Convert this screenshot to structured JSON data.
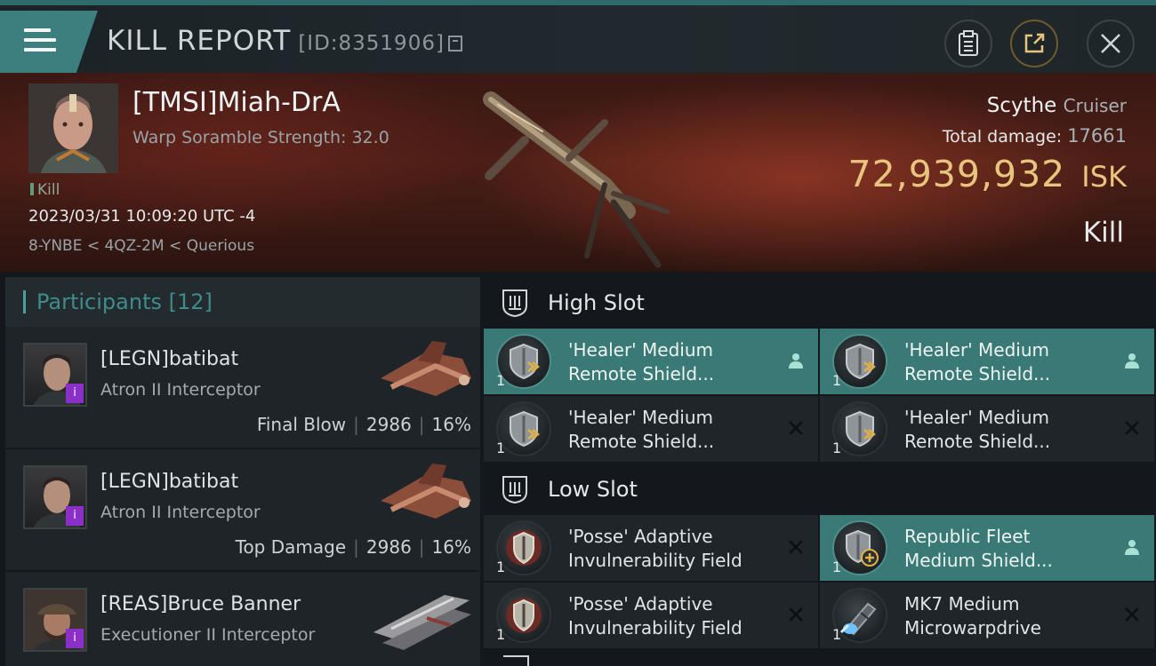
{
  "window": {
    "title": "KILL REPORT",
    "report_id": "[ID:8351906]"
  },
  "header": {
    "pilot_name": "[TMSI]Miah-DrA",
    "warp_scramble": "Warp Soramble Strength: 32.0",
    "event_tag": "Kill",
    "datetime": "2023/03/31 10:09:20 UTC -4",
    "route": "8-YNBE < 4QZ-2M < Querious",
    "ship_name": "Scythe",
    "ship_class": "Cruiser",
    "total_damage_label": "Total damage:",
    "total_damage": "17661",
    "isk_value": "72,939,932",
    "isk_unit": "ISK",
    "result": "Kill"
  },
  "participants": {
    "title": "Participants",
    "count": "[12]",
    "rows": [
      {
        "name": "[LEGN]batibat",
        "ship": "Atron II Interceptor",
        "role": "Final Blow",
        "damage": "2986",
        "percent": "16%"
      },
      {
        "name": "[LEGN]batibat",
        "ship": "Atron II Interceptor",
        "role": "Top Damage",
        "damage": "2986",
        "percent": "16%"
      },
      {
        "name": "[REAS]Bruce Banner",
        "ship": "Executioner II Interceptor",
        "role": "",
        "damage": "",
        "percent": ""
      }
    ]
  },
  "slots": {
    "high": {
      "label": "High Slot",
      "modules": [
        {
          "line1": "'Healer' Medium",
          "line2": "Remote Shield...",
          "qty": "1",
          "state": "fitted"
        },
        {
          "line1": "'Healer' Medium",
          "line2": "Remote Shield...",
          "qty": "1",
          "state": "fitted"
        },
        {
          "line1": "'Healer' Medium",
          "line2": "Remote Shield...",
          "qty": "1",
          "state": "destroyed"
        },
        {
          "line1": "'Healer' Medium",
          "line2": "Remote Shield...",
          "qty": "1",
          "state": "destroyed"
        }
      ]
    },
    "low": {
      "label": "Low Slot",
      "modules": [
        {
          "line1": "'Posse' Adaptive",
          "line2": "Invulnerability Field",
          "qty": "1",
          "state": "destroyed"
        },
        {
          "line1": "Republic Fleet",
          "line2": "Medium Shield...",
          "qty": "1",
          "state": "fitted"
        },
        {
          "line1": "'Posse' Adaptive",
          "line2": "Invulnerability Field",
          "qty": "1",
          "state": "destroyed"
        },
        {
          "line1": "MK7 Medium",
          "line2": "Microwarpdrive",
          "qty": "1",
          "state": "destroyed"
        }
      ]
    }
  },
  "colors": {
    "accent": "#3c7f7e",
    "highlight_row": "#3a7a76",
    "isk": "#e7c57f",
    "badge": "#8b2fc9"
  }
}
